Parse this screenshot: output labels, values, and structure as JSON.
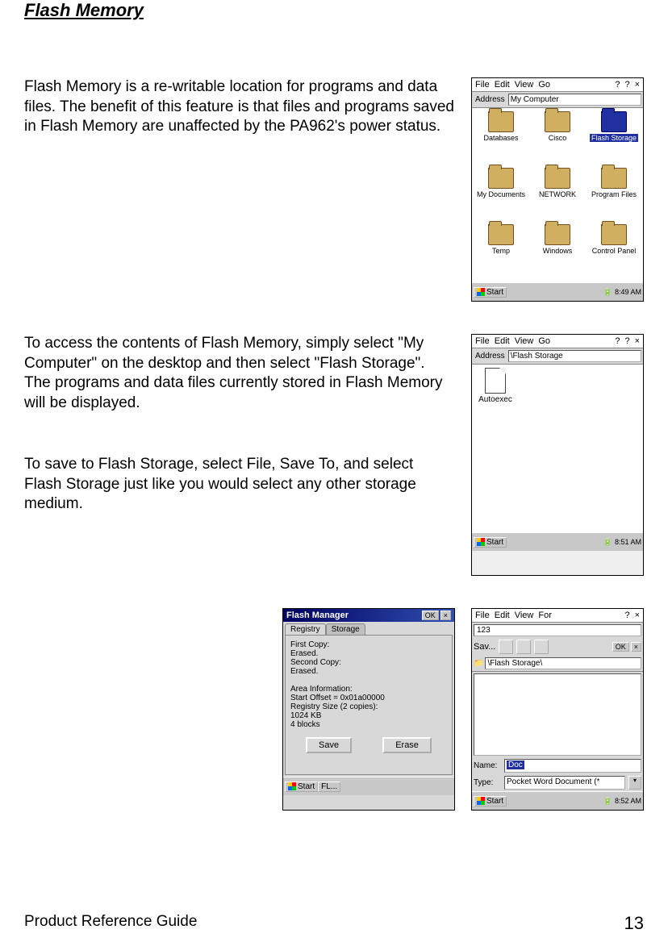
{
  "title": "Flash Memory",
  "para1": "Flash Memory is a re-writable location for programs and data files.  The benefit of this feature is that files and programs saved in Flash Memory are unaffected by the PA962's power status.",
  "para2": "To access the contents of Flash Memory, simply select \"My Computer\" on the desktop and then select \"Flash Storage\".  The programs and data files currently stored in Flash Memory will be displayed.",
  "para3": "To save to Flash Storage, select File, Save To, and select Flash Storage just like you would select any other storage medium.",
  "footer_text": "Product Reference Guide",
  "page_number": "13",
  "menu": {
    "file": "File",
    "edit": "Edit",
    "view": "View",
    "go": "Go",
    "help1": "?",
    "help2": "?",
    "close": "×"
  },
  "shot1": {
    "address_label": "Address",
    "address_value": "My Computer",
    "icons": [
      "Databases",
      "Cisco",
      "Flash Storage",
      "My Documents",
      "NETWORK",
      "Program Files",
      "Temp",
      "Windows",
      "Control Panel"
    ],
    "selected_index": 2,
    "start": "Start",
    "time": "8:49 AM"
  },
  "shot2": {
    "address_label": "Address",
    "address_value": "\\Flash Storage",
    "file": "Autoexec",
    "start": "Start",
    "time": "8:51 AM"
  },
  "shot3": {
    "title": "Flash Manager",
    "ok": "OK",
    "close": "×",
    "tab1": "Registry",
    "tab2": "Storage",
    "line1": "First Copy:",
    "line2": "  Erased.",
    "line3": "Second Copy:",
    "line4": "  Erased.",
    "line5": "Area Information:",
    "line6": "  Start Offset = 0x01a00000",
    "line7": "  Registry Size (2 copies):",
    "line8": "    1024 KB",
    "line9": "    4 blocks",
    "save": "Save",
    "erase": "Erase",
    "start": "Start",
    "task": "FL..."
  },
  "shot4": {
    "menu_for": "For",
    "num": "123",
    "save_label": "Sav...",
    "ok": "OK",
    "close": "×",
    "path": "\\Flash Storage\\",
    "name_label": "Name:",
    "name_value": "Doc",
    "type_label": "Type:",
    "type_value": "Pocket Word Document (*",
    "start": "Start",
    "time": "8:52 AM"
  }
}
